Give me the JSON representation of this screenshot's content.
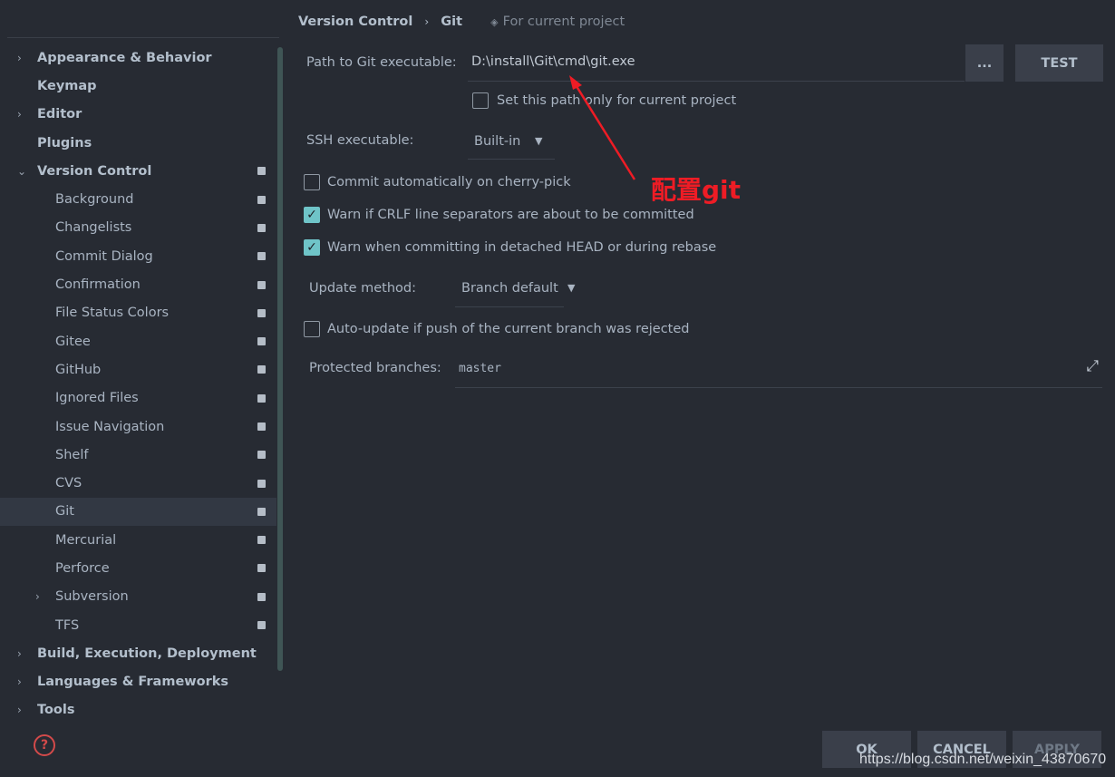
{
  "sidebar": {
    "items": [
      {
        "label": "Appearance & Behavior",
        "level": 0,
        "arrow": "›",
        "badge": false
      },
      {
        "label": "Keymap",
        "level": 0,
        "arrow": "",
        "badge": false
      },
      {
        "label": "Editor",
        "level": 0,
        "arrow": "›",
        "badge": false
      },
      {
        "label": "Plugins",
        "level": 0,
        "arrow": "",
        "badge": false
      },
      {
        "label": "Version Control",
        "level": 0,
        "arrow": "⌄",
        "badge": true
      },
      {
        "label": "Background",
        "level": 1,
        "arrow": "",
        "badge": true
      },
      {
        "label": "Changelists",
        "level": 1,
        "arrow": "",
        "badge": true
      },
      {
        "label": "Commit Dialog",
        "level": 1,
        "arrow": "",
        "badge": true
      },
      {
        "label": "Confirmation",
        "level": 1,
        "arrow": "",
        "badge": true
      },
      {
        "label": "File Status Colors",
        "level": 1,
        "arrow": "",
        "badge": true
      },
      {
        "label": "Gitee",
        "level": 1,
        "arrow": "",
        "badge": true
      },
      {
        "label": "GitHub",
        "level": 1,
        "arrow": "",
        "badge": true
      },
      {
        "label": "Ignored Files",
        "level": 1,
        "arrow": "",
        "badge": true
      },
      {
        "label": "Issue Navigation",
        "level": 1,
        "arrow": "",
        "badge": true
      },
      {
        "label": "Shelf",
        "level": 1,
        "arrow": "",
        "badge": true
      },
      {
        "label": "CVS",
        "level": 1,
        "arrow": "",
        "badge": true
      },
      {
        "label": "Git",
        "level": 1,
        "arrow": "",
        "badge": true,
        "selected": true
      },
      {
        "label": "Mercurial",
        "level": 1,
        "arrow": "",
        "badge": true
      },
      {
        "label": "Perforce",
        "level": 1,
        "arrow": "",
        "badge": true
      },
      {
        "label": "Subversion",
        "level": 1,
        "arrow": "›",
        "badge": true
      },
      {
        "label": "TFS",
        "level": 1,
        "arrow": "",
        "badge": true
      },
      {
        "label": "Build, Execution, Deployment",
        "level": 0,
        "arrow": "›",
        "badge": false
      },
      {
        "label": "Languages & Frameworks",
        "level": 0,
        "arrow": "›",
        "badge": false
      },
      {
        "label": "Tools",
        "level": 0,
        "arrow": "›",
        "badge": false
      }
    ],
    "help_icon": "question-circle-icon"
  },
  "breadcrumb": {
    "parent": "Version Control",
    "sep": "›",
    "current": "Git",
    "scope_icon": "project-scope-icon",
    "scope": "For current project"
  },
  "git_path": {
    "label": "Path to Git executable:",
    "value": "D:\\install\\Git\\cmd\\git.exe",
    "browse": "...",
    "test": "TEST"
  },
  "current_project_only": {
    "label": "Set this path only for current project",
    "checked": false
  },
  "ssh": {
    "label": "SSH executable:",
    "value": "Built-in"
  },
  "options": [
    {
      "label": "Commit automatically on cherry-pick",
      "checked": false
    },
    {
      "label": "Warn if CRLF line separators are about to be committed",
      "checked": true
    },
    {
      "label": "Warn when committing in detached HEAD or during rebase",
      "checked": true
    }
  ],
  "update_method": {
    "label": "Update method:",
    "value": "Branch default"
  },
  "auto_update": {
    "label": "Auto-update if push of the current branch was rejected",
    "checked": false
  },
  "protected": {
    "label": "Protected branches:",
    "value": "master",
    "expand_icon": "expand-icon"
  },
  "annotation": "配置git",
  "footer": {
    "ok": "OK",
    "cancel": "CANCEL",
    "apply": "APPLY"
  },
  "watermark": "https://blog.csdn.net/weixin_43870670",
  "colors": {
    "background": "#272b33",
    "accent_checkbox": "#6fc4c8",
    "annotation": "#ee1c25"
  }
}
